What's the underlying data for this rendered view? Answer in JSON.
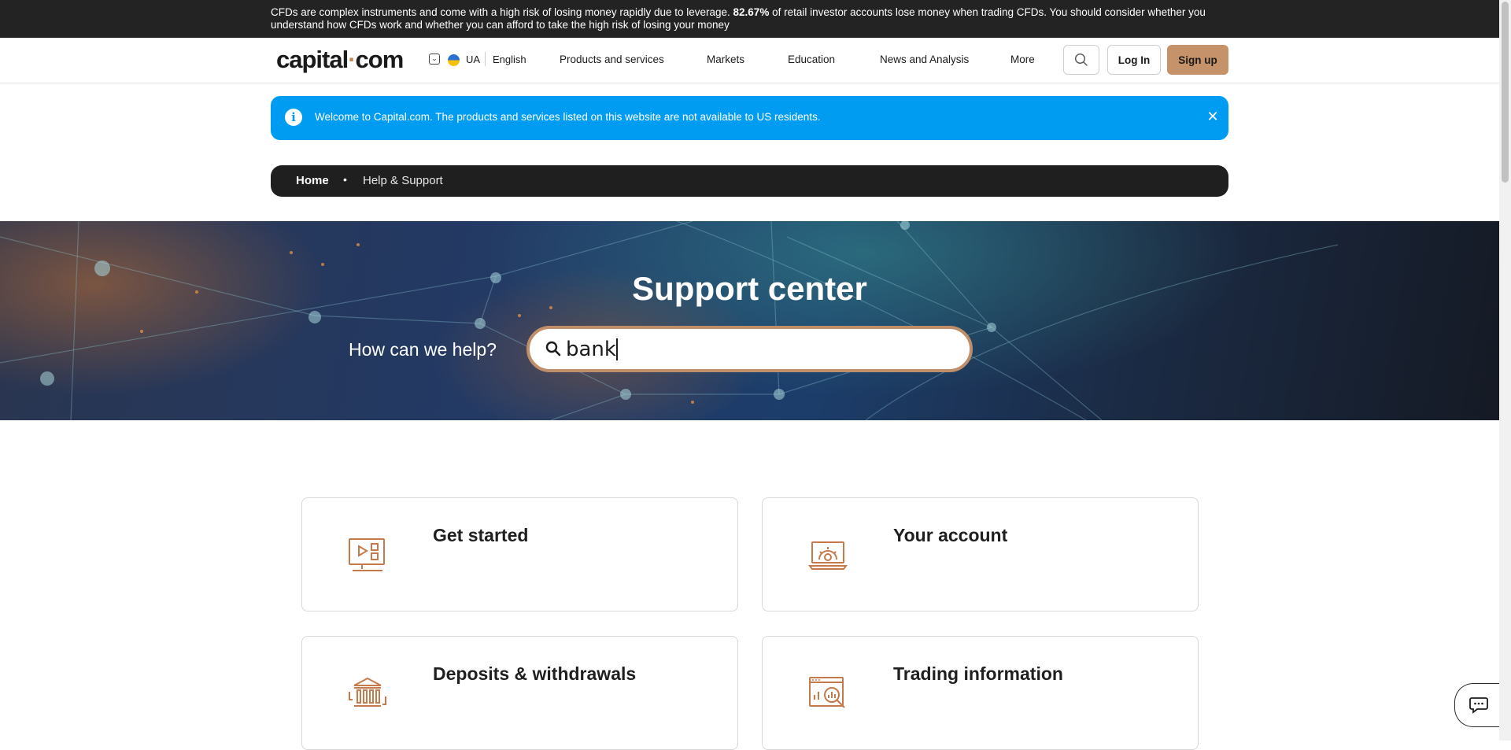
{
  "risk_warning": {
    "text_before": "CFDs are complex instruments and come with a high risk of losing money rapidly due to leverage. ",
    "highlight": "82.67%",
    "text_after": " of retail investor accounts lose money when trading CFDs. You should consider whether you understand how CFDs work and whether you can afford to take the high risk of losing your money"
  },
  "header": {
    "logo": {
      "part1": "capital",
      "dot": "·",
      "part2": "com"
    },
    "language": {
      "dropdown_glyph": "⌄",
      "country_code": "UA",
      "language_name": "English",
      "flag": "flag-ukraine-icon"
    },
    "nav": [
      {
        "label": "Products and services"
      },
      {
        "label": "Markets"
      },
      {
        "label": "Education"
      },
      {
        "label": "News and Analysis"
      },
      {
        "label": "More"
      }
    ],
    "login_label": "Log In",
    "signup_label": "Sign up"
  },
  "notice": {
    "icon_glyph": "i",
    "text": "Welcome to Capital.com. The products and services listed on this website are not available to US residents.",
    "close_glyph": "✕"
  },
  "breadcrumb": {
    "home": "Home",
    "separator": "•",
    "current": "Help & Support"
  },
  "hero": {
    "title": "Support center",
    "prompt": "How can we help?",
    "search_value": "bank"
  },
  "categories": [
    {
      "title": "Get started",
      "icon": "presentation-monitor-icon"
    },
    {
      "title": "Your account",
      "icon": "laptop-settings-icon"
    },
    {
      "title": "Deposits & withdrawals",
      "icon": "bank-transfer-icon"
    },
    {
      "title": "Trading information",
      "icon": "chart-magnifier-icon"
    }
  ],
  "colors": {
    "brand_accent": "#c59269",
    "notice_blue": "#009cf2",
    "dark_bar": "#232323",
    "icon_orange": "#c47a4a"
  }
}
